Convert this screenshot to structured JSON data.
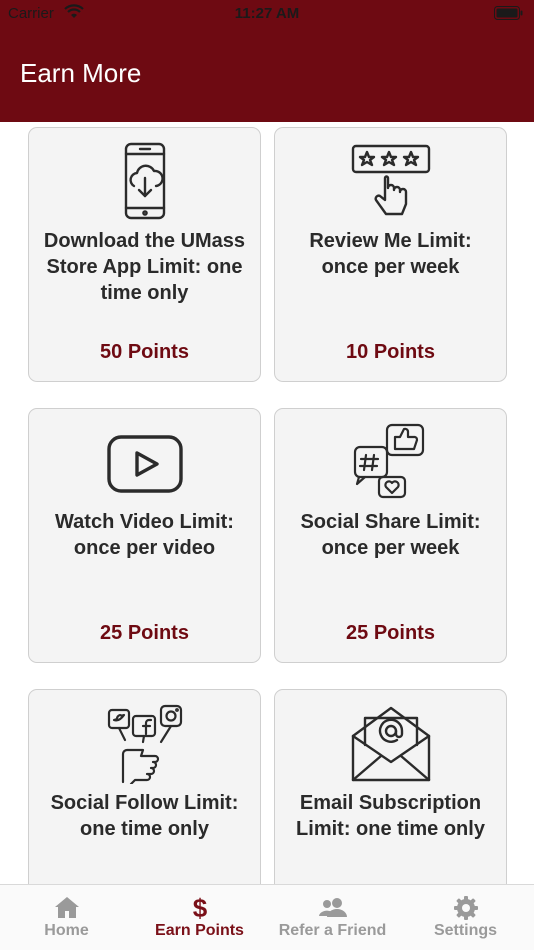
{
  "status_bar": {
    "carrier": "Carrier",
    "time": "11:27 AM"
  },
  "header": {
    "title": "Earn More"
  },
  "cards": [
    {
      "title": "Download the UMass Store App Limit: one time only",
      "points": "50 Points",
      "icon": "phone-cloud-download-icon"
    },
    {
      "title": "Review Me Limit: once per week",
      "points": "10 Points",
      "icon": "star-rating-hand-icon"
    },
    {
      "title": "Watch Video Limit: once per video",
      "points": "25 Points",
      "icon": "video-play-icon"
    },
    {
      "title": "Social Share Limit: once per week",
      "points": "25 Points",
      "icon": "social-share-bubbles-icon"
    },
    {
      "title": "Social Follow Limit: one time only",
      "points": "",
      "icon": "social-follow-hand-icon"
    },
    {
      "title": "Email Subscription Limit: one time only",
      "points": "",
      "icon": "email-envelope-icon"
    }
  ],
  "tabbar": {
    "items": [
      {
        "label": "Home",
        "icon": "home-icon",
        "active": false
      },
      {
        "label": "Earn Points",
        "icon": "dollar-icon",
        "active": true
      },
      {
        "label": "Refer a Friend",
        "icon": "people-icon",
        "active": false
      },
      {
        "label": "Settings",
        "icon": "gear-icon",
        "active": false
      }
    ]
  },
  "colors": {
    "brand": "#6e0a12",
    "card_bg": "#f4f4f4",
    "tab_inactive": "#9a9a9a"
  }
}
